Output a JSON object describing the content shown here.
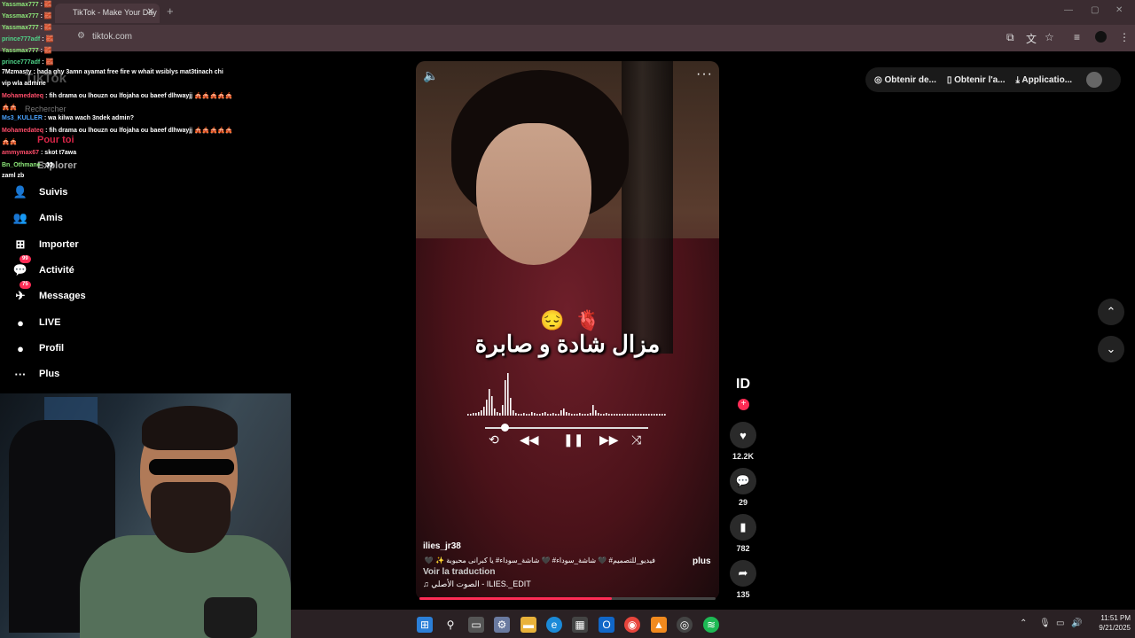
{
  "browser": {
    "tab_title": "TikTok - Make Your Day",
    "url": "tiktok.com"
  },
  "tiktok": {
    "logo": "TikTok",
    "search_placeholder": "Rechercher",
    "sidebar": [
      {
        "label": "Pour toi",
        "icon": "home-icon"
      },
      {
        "label": "Explorer",
        "icon": "compass-icon"
      },
      {
        "label": "Suivis",
        "icon": "following-icon",
        "glyph": "👤"
      },
      {
        "label": "Amis",
        "icon": "friends-icon",
        "glyph": "👥"
      },
      {
        "label": "Importer",
        "icon": "upload-icon",
        "glyph": "⊞"
      },
      {
        "label": "Activité",
        "icon": "activity-icon",
        "glyph": "💬",
        "badge": "99"
      },
      {
        "label": "Messages",
        "icon": "messages-icon",
        "glyph": "✈",
        "badge": "75"
      },
      {
        "label": "LIVE",
        "icon": "live-icon",
        "glyph": "●"
      },
      {
        "label": "Profil",
        "icon": "profile-icon",
        "glyph": "●"
      },
      {
        "label": "Plus",
        "icon": "more-icon",
        "glyph": "···"
      }
    ],
    "top_pills": [
      "Obtenir de...",
      "Obtenir l'a...",
      "Applicatio..."
    ],
    "video": {
      "caption": "مزال شادة و صابرة",
      "username": "ilies_jr38",
      "description": "فيديو_للتصميم# 🖤 شاشة_سوداء# 🖤 شاشة_سوداء# يا كبرانى محبوبة ✨ 🖤 ...",
      "more_label": "plus",
      "translate_label": "Voir la traduction",
      "music": "♫ الصوت الأصلي - ILIES._EDIT",
      "progress": 0.65
    },
    "actions": {
      "likes": "12.2K",
      "comments": "29",
      "saves": "782",
      "shares": "135"
    }
  },
  "chat": [
    {
      "user": "Yassmax777",
      "msg": ": 🧱",
      "color": "#8de87a"
    },
    {
      "user": "Yassmax777",
      "msg": ": 🧱",
      "color": "#8de87a"
    },
    {
      "user": "Yassmax777",
      "msg": ": 🧱",
      "color": "#8de87a"
    },
    {
      "user": "prince777adf",
      "msg": ": 🧱",
      "color": "#4fd68a"
    },
    {
      "user": "Yassmax777",
      "msg": ": 🧱",
      "color": "#8de87a"
    },
    {
      "user": "prince777adf",
      "msg": ": 🧱",
      "color": "#4fd68a"
    },
    {
      "user": "7Mzmasty",
      "msg": ": hada ghy 3amn ayamat free fire w whait wsiblys mat3tinach chi",
      "color": "#ffffff"
    },
    {
      "user": "",
      "msg": "vip wla admine",
      "color": "#ffffff"
    },
    {
      "user": "Mohamedateq",
      "msg": ": fih drama ou lhouzn ou lfojaha ou baeef dlhwayjj 🎪🎪🎪🎪🎪",
      "color": "#ff4d6a"
    },
    {
      "user": "",
      "msg": "🎪🎪",
      "color": "#ffffff"
    },
    {
      "user": "Ms3_KULLER",
      "msg": ": wa kilwa wach 3ndek admin?",
      "color": "#4aa3ff"
    },
    {
      "user": "Mohamedateq",
      "msg": ": fih drama ou lhouzn ou lfojaha ou baeef dlhwayjj 🎪🎪🎪🎪🎪",
      "color": "#ff4d6a"
    },
    {
      "user": "",
      "msg": "🎪🎪",
      "color": "#ffffff"
    },
    {
      "user": "ammymax67",
      "msg": ": skot t7awa",
      "color": "#ff4d6a"
    },
    {
      "user": "Bn_Othmane",
      "msg": ": 👀",
      "color": "#8de87a"
    },
    {
      "user": "",
      "msg": "zaml zb",
      "color": "#ffffff"
    }
  ],
  "taskbar": {
    "time": "11:51 PM",
    "date": "9/21/2025"
  },
  "colors": {
    "accent": "#fe2c55",
    "chrome_bg": "#3b2c31"
  }
}
